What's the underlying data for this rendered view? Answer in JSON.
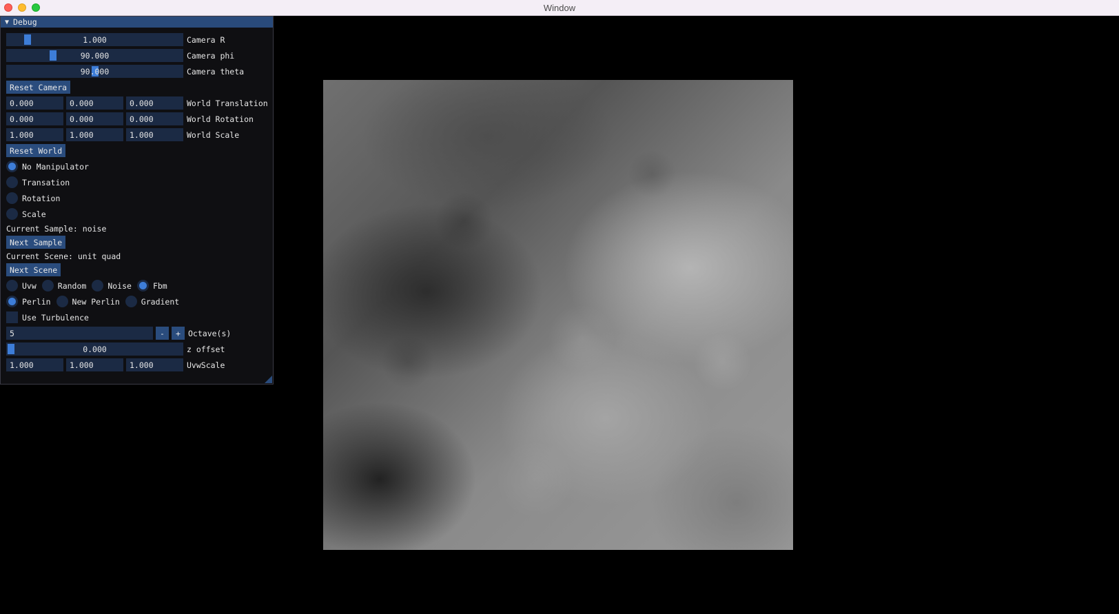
{
  "window": {
    "title": "Window"
  },
  "panel": {
    "title": "Debug",
    "camera": {
      "r": {
        "value": "1.000",
        "label": "Camera R",
        "fraction": 0.1
      },
      "phi": {
        "value": "90.000",
        "label": "Camera phi",
        "fraction": 0.25
      },
      "theta": {
        "value": "90.000",
        "label": "Camera theta",
        "fraction": 0.5
      }
    },
    "reset_camera": "Reset Camera",
    "world": {
      "translation": {
        "values": [
          "0.000",
          "0.000",
          "0.000"
        ],
        "label": "World Translation"
      },
      "rotation": {
        "values": [
          "0.000",
          "0.000",
          "0.000"
        ],
        "label": "World Rotation"
      },
      "scale": {
        "values": [
          "1.000",
          "1.000",
          "1.000"
        ],
        "label": "World Scale"
      }
    },
    "reset_world": "Reset World",
    "manipulators": [
      {
        "label": "No Manipulator",
        "selected": true
      },
      {
        "label": "Transation",
        "selected": false
      },
      {
        "label": "Rotation",
        "selected": false
      },
      {
        "label": "Scale",
        "selected": false
      }
    ],
    "current_sample": "Current Sample: noise",
    "next_sample": "Next Sample",
    "current_scene": "Current Scene: unit quad",
    "next_scene": "Next Scene",
    "mode_options": [
      {
        "label": "Uvw",
        "selected": false
      },
      {
        "label": "Random",
        "selected": false
      },
      {
        "label": "Noise",
        "selected": false
      },
      {
        "label": "Fbm",
        "selected": true
      }
    ],
    "noise_options": [
      {
        "label": "Perlin",
        "selected": true
      },
      {
        "label": "New Perlin",
        "selected": false
      },
      {
        "label": "Gradient",
        "selected": false
      }
    ],
    "use_turbulence": {
      "label": "Use Turbulence",
      "checked": false
    },
    "octaves": {
      "value": "5",
      "minus": "-",
      "plus": "+",
      "label": "Octave(s)"
    },
    "z_offset": {
      "value": "0.000",
      "label": "z offset",
      "fraction": 0.0
    },
    "uvw_scale": {
      "values": [
        "1.000",
        "1.000",
        "1.000"
      ],
      "label": "UvwScale"
    }
  },
  "colors": {
    "panel_bg": "#0f0f12",
    "header": "#294a7a",
    "frame": "#1b2a44",
    "button": "#2a4c7d",
    "accent": "#3d7dd8"
  }
}
